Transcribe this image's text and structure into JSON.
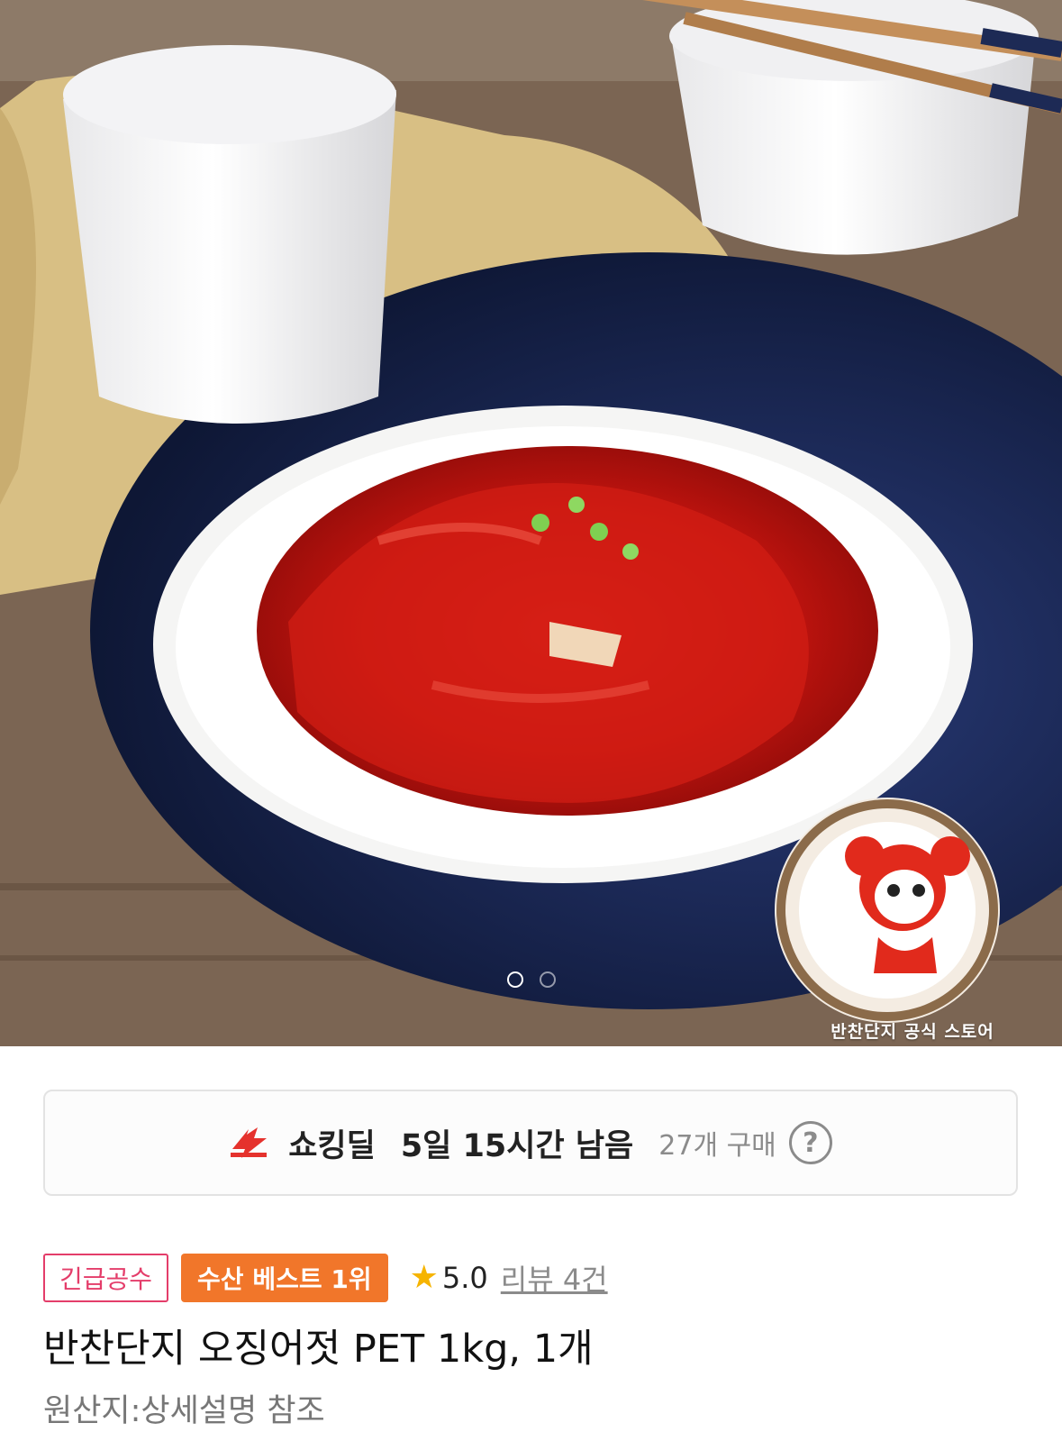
{
  "hero": {
    "image_description_icon": "product-photo",
    "logo_caption": "반찬단지 공식 스토어",
    "carousel": {
      "total": 2,
      "active": 1
    }
  },
  "deal": {
    "icon": "lightning-bolt-icon",
    "name": "쇼킹딜",
    "time_left": "5일 15시간 남음",
    "purchase_count": "27개 구매",
    "help_glyph": "?"
  },
  "badges": {
    "urgent": "긴급공수",
    "best": "수산 베스트 1위"
  },
  "rating": {
    "star_glyph": "★",
    "score": "5.0",
    "reviews": "리뷰 4건"
  },
  "product": {
    "title": "반찬단지 오징어젓 PET 1kg, 1개",
    "origin": "원산지:상세설명 참조"
  },
  "colors": {
    "deal_icon": "#e5322d",
    "urgent_badge": "#e43d6a",
    "best_badge": "#f1762a",
    "star": "#f6b400"
  }
}
